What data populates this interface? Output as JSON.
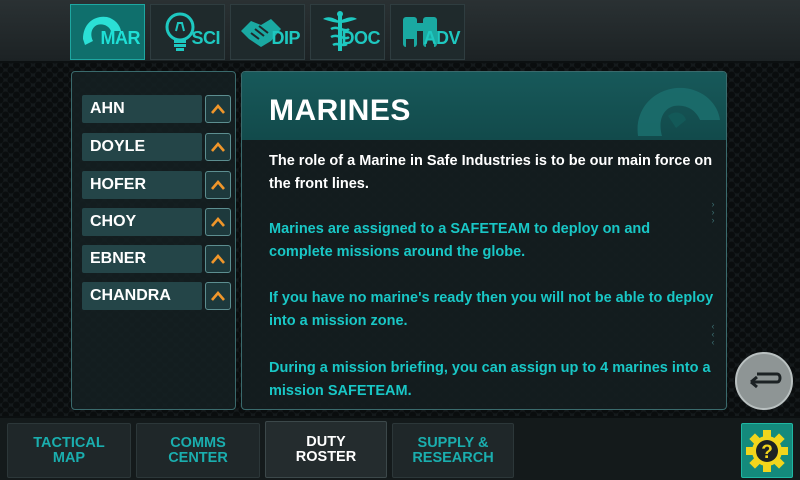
{
  "tabs": [
    {
      "label": "MAR",
      "icon": "marine-helmet-icon",
      "active": true
    },
    {
      "label": "SCI",
      "icon": "lightbulb-icon",
      "active": false
    },
    {
      "label": "DIP",
      "icon": "handshake-icon",
      "active": false
    },
    {
      "label": "DOC",
      "icon": "caduceus-icon",
      "active": false
    },
    {
      "label": "ADV",
      "icon": "binoculars-icon",
      "active": false
    }
  ],
  "roster": [
    {
      "name": "AHN"
    },
    {
      "name": "DOYLE"
    },
    {
      "name": "HOFER"
    },
    {
      "name": "CHOY"
    },
    {
      "name": "EBNER"
    },
    {
      "name": "CHANDRA"
    }
  ],
  "info": {
    "title": "MARINES",
    "paragraphs": [
      "The role of a Marine in Safe Industries is to be our main force on the front lines.",
      "Marines are assigned to a SAFETEAM to deploy on and complete missions around the globe.",
      "If you have no marine's ready then you will not be able to deploy into a mission zone.",
      "During a mission briefing, you can assign up to 4 marines into a mission SAFETEAM."
    ]
  },
  "bottom_nav": [
    {
      "label": "TACTICAL\nMAP",
      "active": false
    },
    {
      "label": "COMMS\nCENTER",
      "active": false
    },
    {
      "label": "DUTY\nROSTER",
      "active": true
    },
    {
      "label": "SUPPLY &\nRESEARCH",
      "active": false
    }
  ],
  "colors": {
    "accent_cyan": "#19c7c6",
    "active_tab": "#0f6f6c",
    "chevron_orange": "#f0962a",
    "help_gear_yellow": "#f2d51c"
  }
}
